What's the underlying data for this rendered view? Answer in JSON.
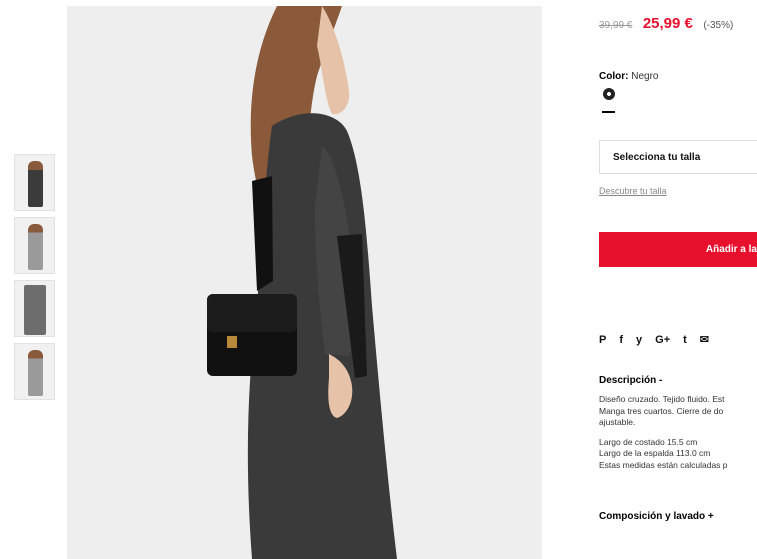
{
  "product": {
    "price_old": "39,99 €",
    "price_new": "25,99 €",
    "discount": "(-35%)",
    "color_label": "Color:",
    "color_value": "Negro",
    "size_select": "Selecciona tu talla",
    "size_guide": "Descubre tu talla",
    "add_button": "Añadir a la",
    "share_icons": [
      "pinterest-icon",
      "facebook-icon",
      "twitter-icon",
      "google-plus-icon",
      "tumblr-icon",
      "email-icon"
    ],
    "share_glyphs": [
      "P",
      "f",
      "y",
      "G+",
      "t",
      "✉"
    ],
    "description_title": "Descripción -",
    "description_lines": [
      "Diseño cruzado. Tejido fluido. Est",
      "Manga tres cuartos. Cierre de do",
      "ajustable."
    ],
    "measure_lines": [
      "Largo de costado 15.5 cm",
      "Largo de la espalda 113.0 cm",
      "Estas medidas están calculadas p"
    ],
    "composition_title": "Composición y lavado +"
  },
  "colors": {
    "accent": "#e8112d",
    "image_bg": "#eeeeee"
  }
}
